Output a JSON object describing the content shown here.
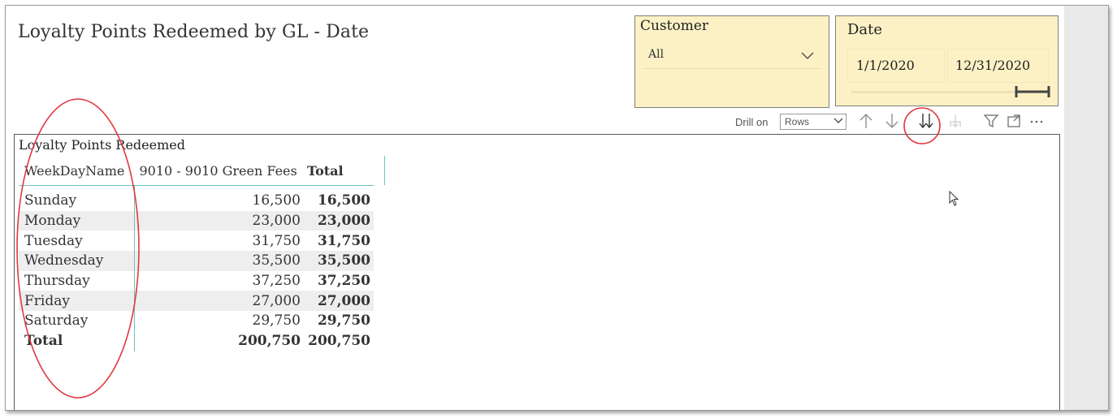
{
  "page": {
    "title": "Loyalty Points Redeemed by GL - Date"
  },
  "customer_slicer": {
    "title": "Customer",
    "selected": "All",
    "bg_color": "#fbf1c4"
  },
  "date_slicer": {
    "title": "Date",
    "start": "1/1/2020",
    "end": "12/31/2020",
    "range_fraction": [
      0,
      1
    ],
    "bg_color": "#fbf1c4"
  },
  "toolbar": {
    "drill_label": "Drill on",
    "drill_value": "Rows",
    "icons": [
      "drill-up-icon",
      "drill-down-icon",
      "go-to-next-level-icon",
      "expand-hierarchy-icon",
      "filter-icon",
      "focus-mode-icon",
      "more-options-icon"
    ]
  },
  "visual": {
    "title": "Loyalty Points Redeemed",
    "headers": [
      "WeekDayName",
      "9010 - 9010 Green Fees",
      "Total"
    ],
    "rows": [
      {
        "name": "Sunday",
        "value": "16,500",
        "total": "16,500"
      },
      {
        "name": "Monday",
        "value": "23,000",
        "total": "23,000"
      },
      {
        "name": "Tuesday",
        "value": "31,750",
        "total": "31,750"
      },
      {
        "name": "Wednesday",
        "value": "35,500",
        "total": "35,500"
      },
      {
        "name": "Thursday",
        "value": "37,250",
        "total": "37,250"
      },
      {
        "name": "Friday",
        "value": "27,000",
        "total": "27,000"
      },
      {
        "name": "Saturday",
        "value": "29,750",
        "total": "29,750"
      }
    ],
    "total_row": {
      "name": "Total",
      "value": "200,750",
      "total": "200,750"
    },
    "accent_color": "#6cc3c3"
  },
  "annotation_color": "#e0393e"
}
